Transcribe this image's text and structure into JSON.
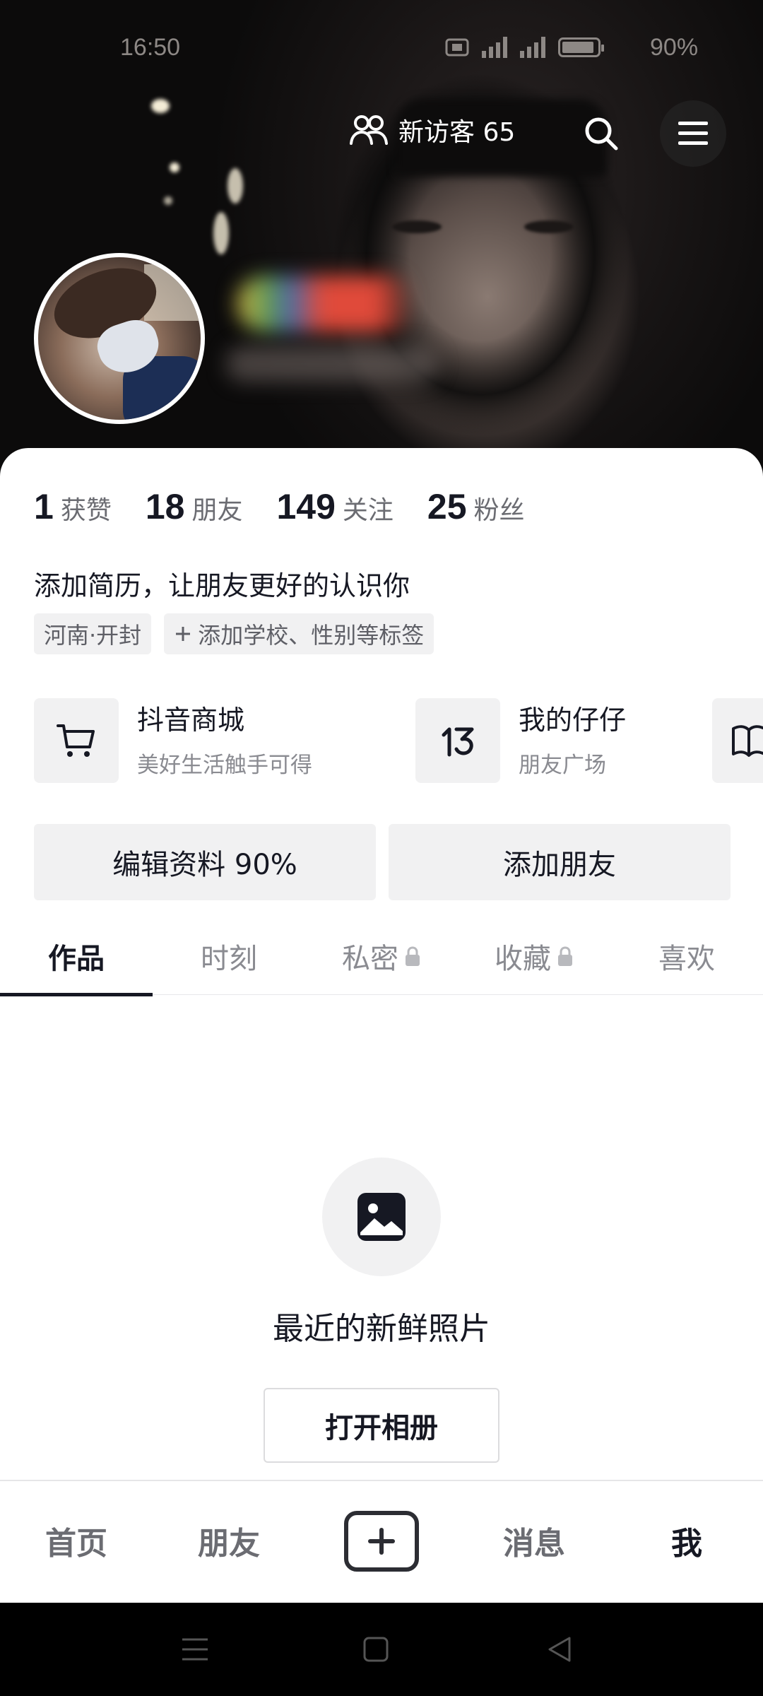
{
  "status_bar": {
    "time": "16:50",
    "battery": "90%",
    "battery_level": 0.9
  },
  "header": {
    "visitors_label": "新访客 65"
  },
  "stats": [
    {
      "num": "1",
      "label": "获赞"
    },
    {
      "num": "18",
      "label": "朋友"
    },
    {
      "num": "149",
      "label": "关注"
    },
    {
      "num": "25",
      "label": "粉丝"
    }
  ],
  "profile": {
    "bio": "添加简历，让朋友更好的认识你",
    "location_tag": "河南·开封",
    "add_tag_label": "添加学校、性别等标签"
  },
  "services": [
    {
      "title": "抖音商城",
      "subtitle": "美好生活触手可得",
      "icon": "cart-icon"
    },
    {
      "title": "我的仔仔",
      "subtitle": "朋友广场",
      "icon": "zaizai-icon"
    },
    {
      "icon": "book-icon"
    }
  ],
  "actions": {
    "edit_profile": "编辑资料 90%",
    "add_friend": "添加朋友"
  },
  "tabs": [
    {
      "label": "作品",
      "active": true
    },
    {
      "label": "时刻"
    },
    {
      "label": "私密",
      "locked": true
    },
    {
      "label": "收藏",
      "locked": true
    },
    {
      "label": "喜欢"
    }
  ],
  "empty_state": {
    "title": "最近的新鲜照片",
    "button": "打开相册",
    "icon": "image-icon"
  },
  "bottom_nav": {
    "home": "首页",
    "friends": "朋友",
    "messages": "消息",
    "me": "我"
  },
  "colors": {
    "text_primary": "#161823",
    "text_secondary": "#8a8b91",
    "chip_bg": "#f1f1f2"
  }
}
